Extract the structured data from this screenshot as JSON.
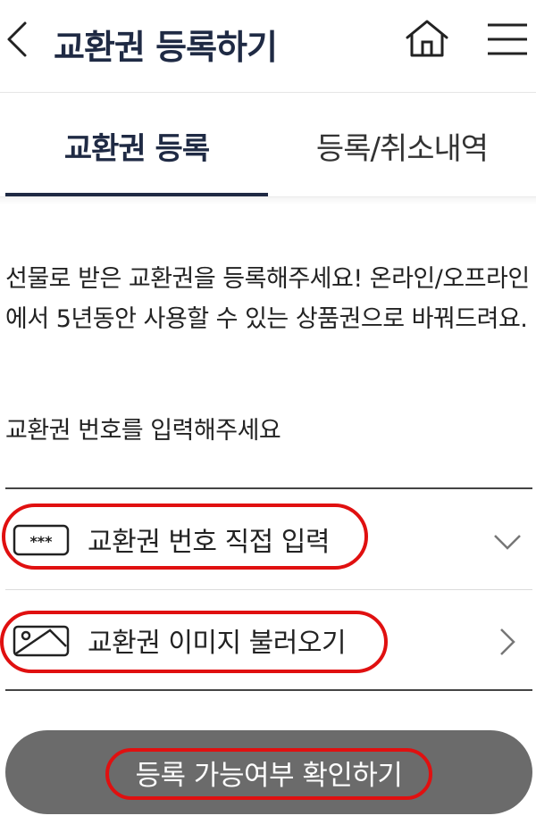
{
  "header": {
    "title": "교환권 등록하기",
    "back_icon": "chevron-left-icon",
    "home_icon": "home-icon",
    "menu_icon": "hamburger-menu-icon"
  },
  "tabs": [
    {
      "label": "교환권 등록",
      "active": true
    },
    {
      "label": "등록/취소내역",
      "active": false
    }
  ],
  "intro": {
    "description": "선물로 받은 교환권을 등록해주세요! 온라인/오프라인에서 5년동안 사용할 수 있는 상품권으로 바꿔드려요.",
    "prompt": "교환권 번호를 입력해주세요"
  },
  "options": [
    {
      "label": "교환권 번호 직접 입력",
      "icon": "password-field-icon",
      "chevron": "chevron-down-icon"
    },
    {
      "label": "교환권 이미지 불러오기",
      "icon": "image-icon",
      "chevron": "chevron-right-icon"
    }
  ],
  "confirm_button": {
    "label": "등록 가능여부 확인하기"
  },
  "colors": {
    "primary_navy": "#1f2a44",
    "button_gray": "#6b6b6b",
    "highlight_red": "#e01010",
    "divider": "#444444"
  }
}
